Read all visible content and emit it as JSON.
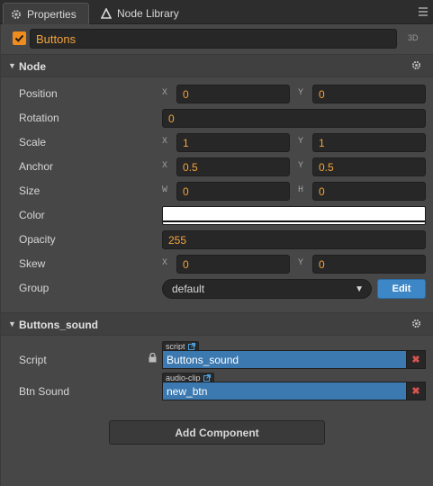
{
  "tabs": [
    {
      "label": "Properties",
      "icon": "gear-icon",
      "active": true
    },
    {
      "label": "Node Library",
      "icon": "triangle-icon",
      "active": false
    }
  ],
  "node": {
    "enabled": true,
    "name": "Buttons",
    "mode_3d_label": "3D"
  },
  "node_section": {
    "title": "Node",
    "position": {
      "label": "Position",
      "x_axis": "X",
      "x": "0",
      "y_axis": "Y",
      "y": "0"
    },
    "rotation": {
      "label": "Rotation",
      "value": "0"
    },
    "scale": {
      "label": "Scale",
      "x_axis": "X",
      "x": "1",
      "y_axis": "Y",
      "y": "1"
    },
    "anchor": {
      "label": "Anchor",
      "x_axis": "X",
      "x": "0.5",
      "y_axis": "Y",
      "y": "0.5"
    },
    "size": {
      "label": "Size",
      "w_axis": "W",
      "w": "0",
      "h_axis": "H",
      "h": "0"
    },
    "color": {
      "label": "Color",
      "value": "#ffffff"
    },
    "opacity": {
      "label": "Opacity",
      "value": "255"
    },
    "skew": {
      "label": "Skew",
      "x_axis": "X",
      "x": "0",
      "y_axis": "Y",
      "y": "0"
    },
    "group": {
      "label": "Group",
      "value": "default",
      "edit_label": "Edit"
    }
  },
  "component": {
    "title": "Buttons_sound",
    "script": {
      "label": "Script",
      "tag": "script",
      "value": "Buttons_sound"
    },
    "btn_sound": {
      "label": "Btn Sound",
      "tag": "audio-clip",
      "value": "new_btn"
    }
  },
  "add_component_label": "Add Component",
  "colors": {
    "accent": "#f08c1e",
    "asset_blue": "#3b79b0",
    "edit_blue": "#3d87c6",
    "clear_red": "#d9534f"
  }
}
